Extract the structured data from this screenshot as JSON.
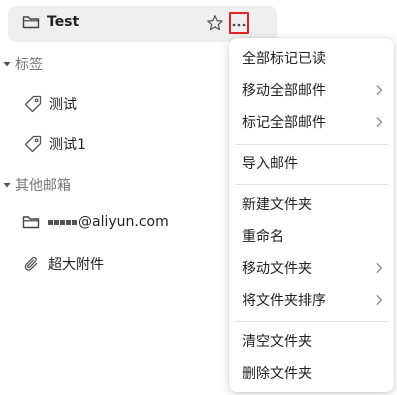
{
  "sidebar": {
    "selected_folder": {
      "label": "Test",
      "icon": "folder-icon"
    },
    "tags_section": {
      "label": "标签",
      "items": [
        {
          "label": "测试",
          "icon": "tag-icon"
        },
        {
          "label": "测试1",
          "icon": "tag-icon"
        }
      ]
    },
    "other_mailboxes_section": {
      "label": "其他邮箱",
      "items": [
        {
          "label": "@aliyun.com",
          "icon": "folder-icon",
          "masked_prefix": true
        },
        {
          "label": "超大附件",
          "icon": "paperclip-icon"
        }
      ]
    }
  },
  "menu": {
    "items": [
      {
        "label": "全部标记已读",
        "has_submenu": false
      },
      {
        "label": "移动全部邮件",
        "has_submenu": true
      },
      {
        "label": "标记全部邮件",
        "has_submenu": true
      },
      {
        "label": "导入邮件",
        "has_submenu": false
      },
      {
        "label": "新建文件夹",
        "has_submenu": false
      },
      {
        "label": "重命名",
        "has_submenu": false
      },
      {
        "label": "移动文件夹",
        "has_submenu": true
      },
      {
        "label": "将文件夹排序",
        "has_submenu": true
      },
      {
        "label": "清空文件夹",
        "has_submenu": false
      },
      {
        "label": "删除文件夹",
        "has_submenu": false
      }
    ]
  },
  "colors": {
    "highlight_border": "#e02424",
    "selected_row_bg": "#efefef",
    "section_text": "#777777"
  }
}
